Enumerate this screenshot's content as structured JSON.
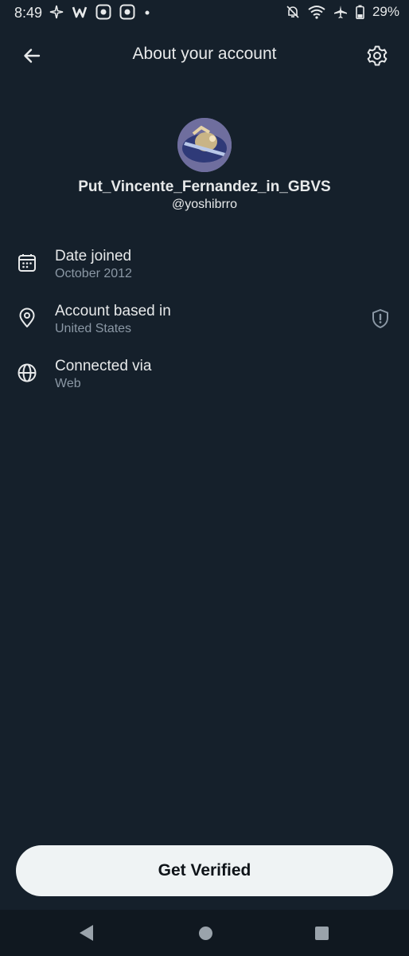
{
  "status_bar": {
    "time": "8:49",
    "battery": "29%",
    "left_icons": [
      "sparkle-icon",
      "w-app-icon",
      "app-icon",
      "app-icon",
      "dot-icon"
    ],
    "right_icons": [
      "notifications-off-icon",
      "wifi-icon",
      "airplane-icon",
      "battery-icon"
    ]
  },
  "header": {
    "title": "About your account",
    "back_icon": "arrow-left-icon",
    "settings_icon": "gear-icon"
  },
  "profile": {
    "display_name": "Put_Vincente_Fernandez_in_GBVS",
    "handle": "@yoshibrro"
  },
  "info": [
    {
      "icon": "calendar-icon",
      "title": "Date joined",
      "value": "October 2012"
    },
    {
      "icon": "location-pin-icon",
      "title": "Account based in",
      "value": "United States",
      "badge_icon": "shield-alert-icon"
    },
    {
      "icon": "globe-icon",
      "title": "Connected via",
      "value": "Web"
    }
  ],
  "actions": {
    "verify_label": "Get Verified"
  },
  "colors": {
    "background": "#15202b",
    "text_primary": "#e7e9ea",
    "text_secondary": "#8b98a5",
    "button_bg": "#eff3f4",
    "button_text": "#0f1419"
  }
}
